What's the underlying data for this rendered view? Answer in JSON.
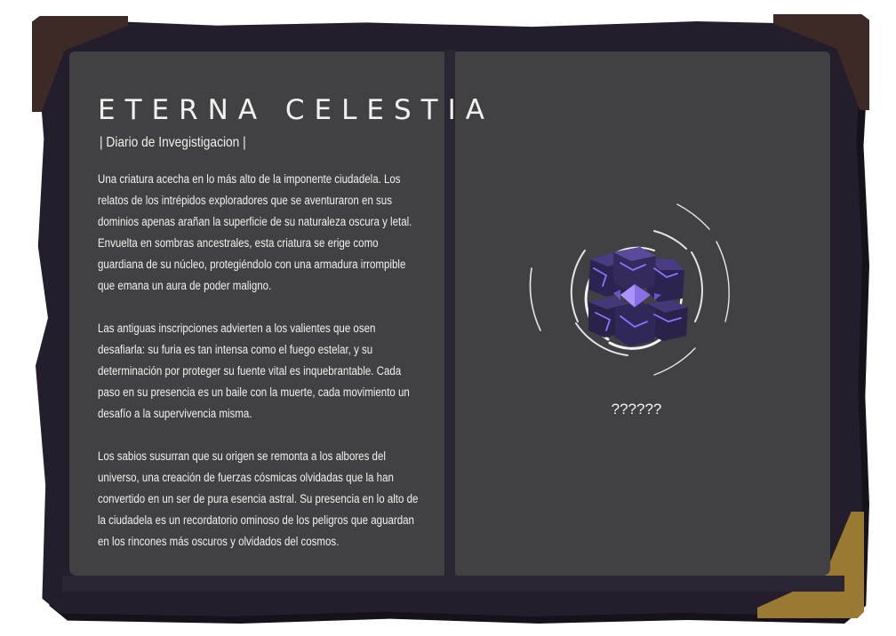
{
  "journal": {
    "title": "ETERNA CELESTIA",
    "subtitle": "| Diario de Invegistigacion |",
    "paragraphs": [
      "Una criatura acecha en lo más alto de la imponente ciudadela. Los relatos de los intrépidos exploradores que se aventuraron en sus dominios apenas arañan la superficie de su naturaleza oscura y letal. Envuelta en sombras ancestrales, esta criatura se erige como guardiana de su núcleo, protegiéndolo con una armadura irrompible que emana un aura de poder maligno.",
      "Las antiguas inscripciones advierten a los valientes que osen desafiarla: su furia es tan intensa como el fuego estelar, y su determinación por proteger su fuente vital es inquebrantable. Cada paso en su presencia es un baile con la muerte, cada movimiento un desafío a la supervivencia misma.",
      "Los sabios susurran que su origen se remonta a los albores del universo, una creación de fuerzas cósmicas olvidadas que la han convertido en un ser de pura esencia astral. Su presencia en lo alto de la ciudadela es un recordatorio ominoso de los peligros que aguardan en los rincones más oscuros y olvidados del cosmos."
    ]
  },
  "creature": {
    "name": "??????",
    "icon": "purple-crystal-cube-creature-icon"
  },
  "colors": {
    "frame": "#241d2b",
    "page": "#414143",
    "corner_brown": "#3b2a26",
    "corner_gold": "#9a7a32",
    "text": "#f1f1f1",
    "crystal": "#3a2f62"
  }
}
